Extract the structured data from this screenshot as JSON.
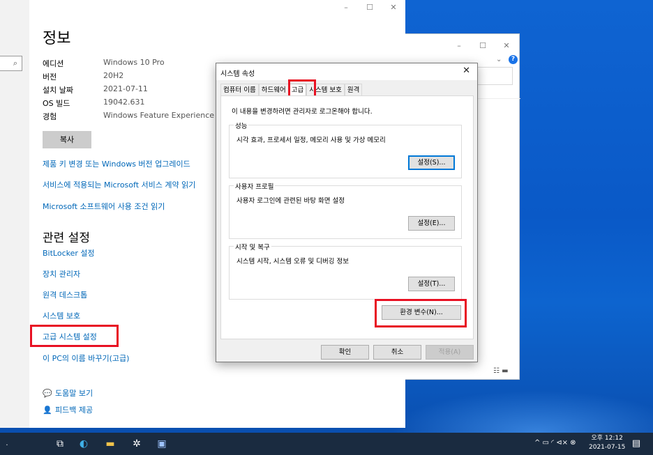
{
  "settings": {
    "title": "정보",
    "search_icon": "⌕",
    "window_controls": {
      "minimize": "–",
      "maximize": "☐",
      "close": "✕"
    },
    "specs": [
      {
        "label": "에디션",
        "value": "Windows 10 Pro"
      },
      {
        "label": "버전",
        "value": "20H2"
      },
      {
        "label": "설치 날짜",
        "value": "2021-07-11"
      },
      {
        "label": "OS 빌드",
        "value": "19042.631"
      },
      {
        "label": "경험",
        "value": "Windows Feature Experience Pac"
      }
    ],
    "copy_button": "복사",
    "links": {
      "product_key": "제품 키 변경 또는 Windows 버전 업그레이드",
      "service_agreement": "서비스에 적용되는 Microsoft 서비스 계약 읽기",
      "license_terms": "Microsoft 소프트웨어 사용 조건 읽기"
    },
    "related_heading": "관련 설정",
    "related_links": {
      "bitlocker": "BitLocker 설정",
      "device_manager": "장치 관리자",
      "remote_desktop": "원격 데스크톱",
      "system_protection": "시스템 보호",
      "advanced_system": "고급 시스템 설정",
      "rename_pc": "이 PC의 이름 바꾸기(고급)"
    },
    "help": {
      "get_help": "도움말 보기",
      "feedback": "피드백 제공",
      "help_icon": "💬",
      "feedback_icon": "👤"
    }
  },
  "explorer": {
    "minimize": "–",
    "maximize": "☐",
    "close": "✕",
    "chevron": "⌄",
    "help": "?",
    "view_icons": "☷ ▬"
  },
  "dialog": {
    "title": "시스템 속성",
    "close": "✕",
    "tabs": [
      "컴퓨터 이름",
      "하드웨어",
      "고급",
      "시스템 보호",
      "원격"
    ],
    "active_tab": "고급",
    "admin_note": "이 내용을 변경하려면 관리자로 로그온해야 합니다.",
    "performance": {
      "label": "성능",
      "desc": "시각 효과, 프로세서 일정, 메모리 사용 및 가상 메모리",
      "button": "설정(S)..."
    },
    "user_profiles": {
      "label": "사용자 프로필",
      "desc": "사용자 로그인에 관련된 바탕 화면 설정",
      "button": "설정(E)..."
    },
    "startup": {
      "label": "시작 및 복구",
      "desc": "시스템 시작, 시스템 오류 및 디버깅 정보",
      "button": "설정(T)..."
    },
    "env_button": "환경 변수(N)...",
    "ok": "확인",
    "cancel": "취소",
    "apply": "적용(A)"
  },
  "taskbar": {
    "search_fragment": ".",
    "task_view_icon": "⧉",
    "edge_icon": "◐",
    "explorer_icon": "▬",
    "settings_icon": "✲",
    "app_icon": "▣",
    "tray_text": "^ ▭ ◜ ⊲× ⊗",
    "time": "오후 12:12",
    "date": "2021-07-15",
    "notifications_icon": "▤"
  },
  "colors": {
    "accent": "#0067b8",
    "highlight": "#e81123",
    "taskbar": "#1a2b40"
  }
}
